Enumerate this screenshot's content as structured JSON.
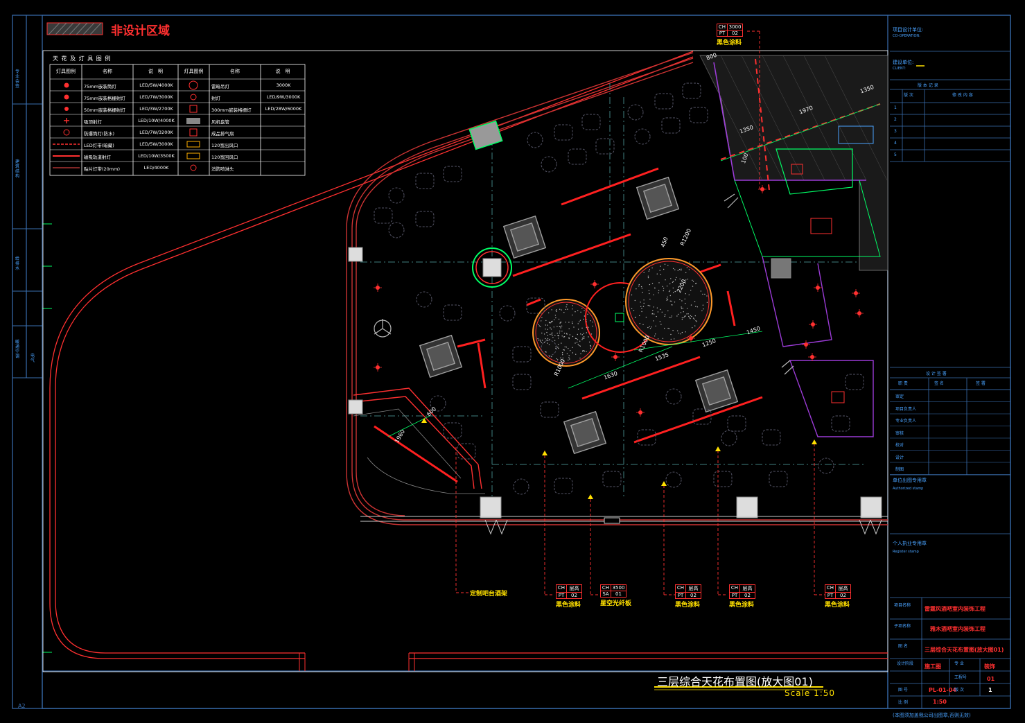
{
  "colors": {
    "background": "#000000",
    "frame": "#3a6fb0",
    "wall": "#ff3030",
    "grid": "#3f7f7f",
    "glass": "#00ff66",
    "tile": "#a0a0a0",
    "titlebar_cyan": "#4aa3ff"
  },
  "header": {
    "hatch_label": "非设计区域"
  },
  "legend": {
    "title": "天 花 及 灯 具 图 例",
    "col_headers": [
      "灯具图例",
      "名称",
      "说　明",
      "灯具图例",
      "名称",
      "说　明"
    ],
    "rows": [
      [
        "",
        "75mm嵌装筒灯",
        "LED/5W/4000K",
        "",
        "雷暗吊灯",
        "3000K"
      ],
      [
        "",
        "75mm嵌装格栅射灯",
        "LED/7W/3000K",
        "",
        "射灯",
        "LED/9W/3000K"
      ],
      [
        "",
        "50mm嵌装格栅射灯",
        "LED/3W/2700K",
        "",
        "300mm嵌装格栅灯",
        "LED/28W/6000K"
      ],
      [
        "",
        "吸顶射灯",
        "LED/10W/4000K",
        "",
        "风机盘管",
        ""
      ],
      [
        "",
        "防爆筒灯(防水)",
        "LED/7W/3200K",
        "",
        "成品排气扇",
        ""
      ],
      [
        "",
        "LED灯带(暗藏)",
        "LED/5W/3000K",
        "",
        "120宽出风口",
        ""
      ],
      [
        "",
        "磁吸轨道射灯",
        "LED/10W/3500K",
        "",
        "120宽回风口",
        ""
      ],
      [
        "",
        "贴片灯带(20mm)",
        "LED/4000K",
        "",
        "消防喷淋头",
        ""
      ]
    ]
  },
  "left_strip": {
    "labels": [
      "专业会签",
      "建筑结构",
      "给排水",
      "暖通空调",
      "电气"
    ]
  },
  "callouts": {
    "top": {
      "ch": "CH",
      "ch_val": "3000",
      "pt": "PT",
      "pt_val": "02",
      "text": "黑色涂料"
    },
    "bottom": [
      {
        "ch": "CH",
        "ch_val": "层高",
        "pt": "PT",
        "pt_val": "02",
        "text": "黑色涂料"
      },
      {
        "ch": "CH",
        "ch_val": "3500",
        "pt": "SA",
        "pt_val": "01",
        "text": "星空光纤板"
      },
      {
        "ch": "CH",
        "ch_val": "层高",
        "pt": "PT",
        "pt_val": "02",
        "text": "黑色涂料"
      },
      {
        "ch": "CH",
        "ch_val": "层高",
        "pt": "PT",
        "pt_val": "02",
        "text": "黑色涂料"
      },
      {
        "ch": "CH",
        "ch_val": "层高",
        "pt": "PT",
        "pt_val": "02",
        "text": "黑色涂料"
      }
    ],
    "bar_note": "定制吧台酒架"
  },
  "dimensions": [
    "1350",
    "1970",
    "1350",
    "R1200",
    "2200",
    "1250",
    "1450",
    "1535",
    "1630",
    "R1000",
    "R1000",
    "1960",
    "600",
    "450",
    "100",
    "800"
  ],
  "drawing_title": {
    "title": "三层综合天花布置图(放大图01)",
    "scale": "Scale 1:50"
  },
  "title_block": {
    "co_design": "项目设计单位:",
    "co_design_en": "CO-OPERATION:",
    "client": "建设单位:",
    "client_en": "CLIENT:",
    "revision_header": "版 本 记 录",
    "revision_cols": [
      "版 次",
      "修 改 内 容"
    ],
    "revision_rows": [
      "1",
      "2",
      "3",
      "4",
      "5"
    ],
    "signature_header": "设 计 签 署",
    "signature_cols": [
      "职 责",
      "签 名",
      "签 署"
    ],
    "signature_rows": [
      "审定",
      "项目负责人",
      "专业负责人",
      "审核",
      "校对",
      "设计",
      "制图"
    ],
    "stamp1": "单位出图专用章",
    "stamp1_en": "Authorized stamp",
    "stamp2": "个人执业专用章",
    "stamp2_en": "Register stamp",
    "project_label": "项目名称",
    "project_name": "雷霆风酒吧室内装饰工程",
    "subproject_label": "子项名称",
    "subproject_name": "雅木酒吧室内装饰工程",
    "drawing_label": "图 名",
    "drawing_name": "三层综合天花布置图(放大图01)",
    "stage_label": "设计阶段",
    "stage": "施工图",
    "discipline_label": "专 业",
    "discipline": "装饰",
    "number_label": "工程号",
    "number_val": "01",
    "drawing_no_label": "图 号",
    "drawing_no": "PL-01-04",
    "version_label": "版 次",
    "version": "1",
    "ratio_label": "比 例",
    "ratio": "1:50",
    "footer_note": "(本图须加盖我公司出图章,否则无效)"
  },
  "sheet_size": "A2"
}
